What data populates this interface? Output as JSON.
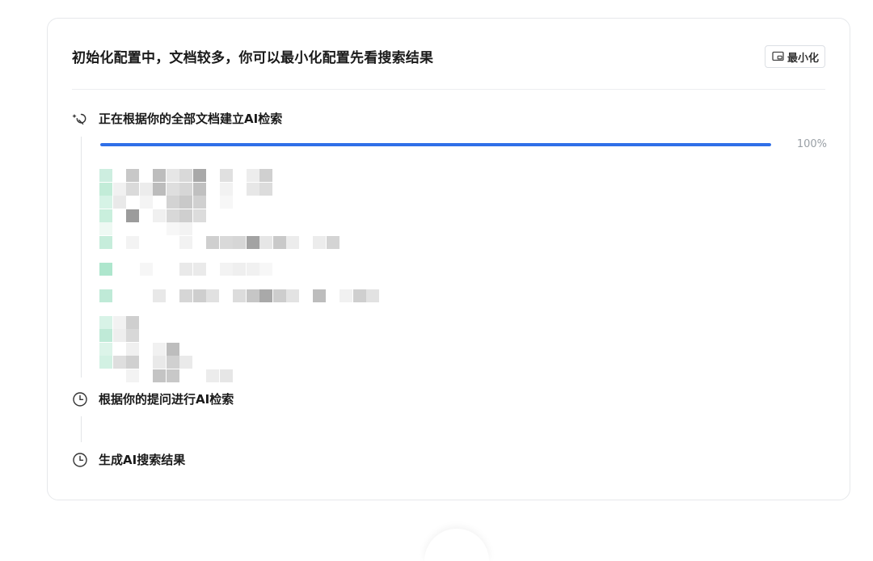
{
  "dialog": {
    "title": "初始化配置中，文档较多，你可以最小化配置先看搜索结果",
    "minimize_label": "最小化"
  },
  "steps": [
    {
      "label": "正在根据你的全部文档建立AI检索",
      "icon": "magic-wand-icon",
      "status": "in-progress"
    },
    {
      "label": "根据你的提问进行AI检索",
      "icon": "clock-icon",
      "status": "pending"
    },
    {
      "label": "生成AI搜索结果",
      "icon": "clock-icon",
      "status": "pending"
    }
  ],
  "progress": {
    "value": 1.0,
    "label": "100%"
  },
  "colors": {
    "accent": "#2f6fe8",
    "track": "#e8edf5",
    "border": "#e6e8eb",
    "muted": "#9aa0a6"
  }
}
